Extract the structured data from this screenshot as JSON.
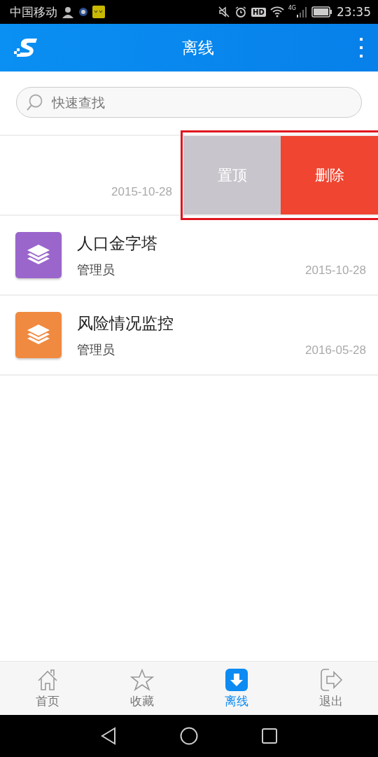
{
  "status_bar": {
    "carrier": "中国移动",
    "hd": "HD",
    "network": "4G",
    "time": "23:35"
  },
  "app_bar": {
    "title": "离线"
  },
  "search": {
    "placeholder": "快速查找"
  },
  "items": [
    {
      "kind": "swiped",
      "date": "2015-10-28",
      "actions": [
        {
          "kind": "pin",
          "label": "置顶"
        },
        {
          "kind": "delete",
          "label": "删除"
        }
      ]
    },
    {
      "kind": "entry",
      "title": "人口金字塔",
      "owner": "管理员",
      "date": "2015-10-28",
      "color": "#9a66cc"
    },
    {
      "kind": "entry",
      "title": "风险情况监控",
      "owner": "管理员",
      "date": "2016-05-28",
      "color": "#f08a40"
    }
  ],
  "tabs": [
    {
      "kind": "home",
      "label": "首页",
      "selected": false
    },
    {
      "kind": "star",
      "label": "收藏",
      "selected": false
    },
    {
      "kind": "offline",
      "label": "离线",
      "selected": true
    },
    {
      "kind": "exit",
      "label": "退出",
      "selected": false
    }
  ]
}
